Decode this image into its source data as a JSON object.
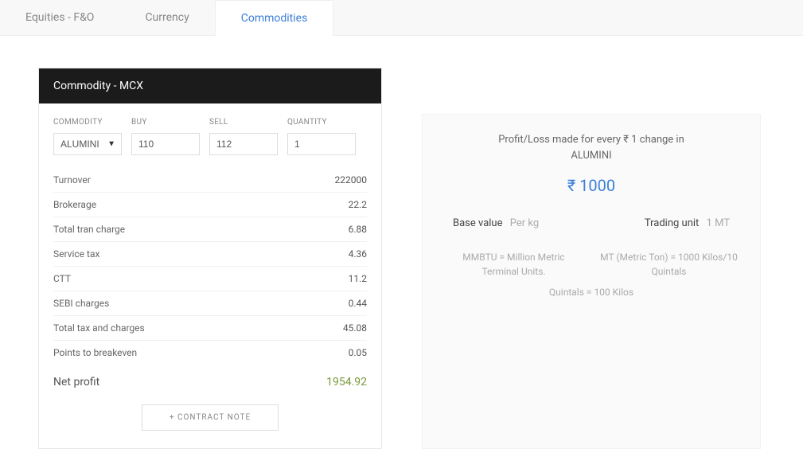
{
  "tabs": {
    "equities": "Equities - F&O",
    "currency": "Currency",
    "commodities": "Commodities"
  },
  "card": {
    "title": "Commodity - MCX",
    "fields": {
      "commodity_label": "COMMODITY",
      "commodity_value": "ALUMINI",
      "buy_label": "BUY",
      "buy_value": "110",
      "sell_label": "SELL",
      "sell_value": "112",
      "quantity_label": "QUANTITY",
      "quantity_value": "1"
    },
    "rows": {
      "turnover_label": "Turnover",
      "turnover_value": "222000",
      "brokerage_label": "Brokerage",
      "brokerage_value": "22.2",
      "tran_label": "Total tran charge",
      "tran_value": "6.88",
      "servicetax_label": "Service tax",
      "servicetax_value": "4.36",
      "ctt_label": "CTT",
      "ctt_value": "11.2",
      "sebi_label": "SEBI charges",
      "sebi_value": "0.44",
      "totaltax_label": "Total tax and charges",
      "totaltax_value": "45.08",
      "breakeven_label": "Points to breakeven",
      "breakeven_value": "0.05"
    },
    "net": {
      "label": "Net profit",
      "value": "1954.92"
    },
    "contract_btn": "+ CONTRACT NOTE"
  },
  "info": {
    "pl_line1": "Profit/Loss made for every ₹ 1 change in",
    "pl_line2": "ALUMINI",
    "pl_amount": "₹ 1000",
    "base_label": "Base value",
    "base_value": "Per kg",
    "unit_label": "Trading unit",
    "unit_value": "1 MT",
    "note_mmbtu": "MMBTU = Million Metric Terminal Units.",
    "note_mt": "MT (Metric Ton) = 1000 Kilos/10 Quintals",
    "note_quintal": "Quintals = 100 Kilos"
  }
}
